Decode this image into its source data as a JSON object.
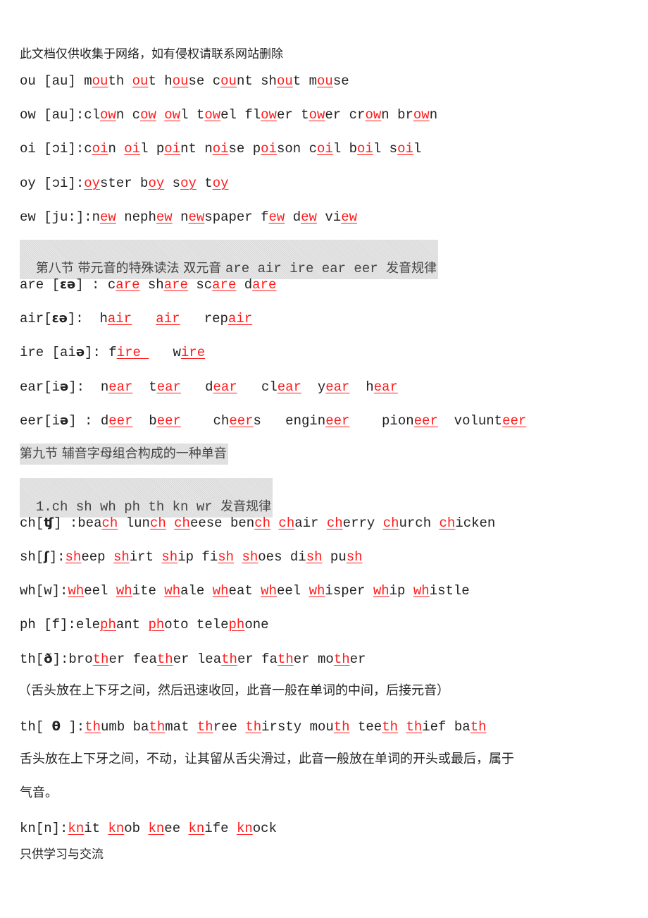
{
  "document": {
    "header_notice": "此文档仅供收集于网络，如有侵权请联系网站删除",
    "footer_notice": "只供学习与交流",
    "highlight_color": "#ff1a1a",
    "heading_bg_color": "#e2e2e2"
  },
  "lines": [
    {
      "prefix": "ou [au] ",
      "words": [
        {
          "pre": "m",
          "hl": "ou",
          "post": "th"
        },
        {
          "pre": "",
          "hl": "ou",
          "post": "t"
        },
        {
          "pre": "h",
          "hl": "ou",
          "post": "se"
        },
        {
          "pre": "c",
          "hl": "ou",
          "post": "nt"
        },
        {
          "pre": "sh",
          "hl": "ou",
          "post": "t"
        },
        {
          "pre": "m",
          "hl": "ou",
          "post": "se"
        }
      ]
    },
    {
      "prefix": "ow [au]:",
      "words": [
        {
          "pre": "cl",
          "hl": "ow",
          "post": "n"
        },
        {
          "pre": "c",
          "hl": "ow",
          "post": ""
        },
        {
          "pre": "",
          "hl": "ow",
          "post": "l"
        },
        {
          "pre": "t",
          "hl": "ow",
          "post": "el"
        },
        {
          "pre": "fl",
          "hl": "ow",
          "post": "er"
        },
        {
          "pre": "t",
          "hl": "ow",
          "post": "er"
        },
        {
          "pre": "cr",
          "hl": "ow",
          "post": "n"
        },
        {
          "pre": "br",
          "hl": "ow",
          "post": "n"
        }
      ]
    },
    {
      "prefix": "oi [ɔi]:",
      "words": [
        {
          "pre": "c",
          "hl": "oi",
          "post": "n"
        },
        {
          "pre": "",
          "hl": "oi",
          "post": "l"
        },
        {
          "pre": "p",
          "hl": "oi",
          "post": "nt"
        },
        {
          "pre": "n",
          "hl": "oi",
          "post": "se"
        },
        {
          "pre": "p",
          "hl": "oi",
          "post": "son"
        },
        {
          "pre": "c",
          "hl": "oi",
          "post": "l"
        },
        {
          "pre": "b",
          "hl": "oi",
          "post": "l"
        },
        {
          "pre": "s",
          "hl": "oi",
          "post": "l"
        }
      ]
    },
    {
      "prefix": "oy [ɔi]:",
      "words": [
        {
          "pre": "",
          "hl": "oy",
          "post": "ster"
        },
        {
          "pre": "b",
          "hl": "oy",
          "post": ""
        },
        {
          "pre": "s",
          "hl": "oy",
          "post": ""
        },
        {
          "pre": "t",
          "hl": "oy",
          "post": ""
        }
      ]
    },
    {
      "prefix": "ew [ju:]:",
      "words": [
        {
          "pre": "n",
          "hl": "ew",
          "post": ""
        },
        {
          "pre": "neph",
          "hl": "ew",
          "post": ""
        },
        {
          "pre": "n",
          "hl": "ew",
          "post": "spaper"
        },
        {
          "pre": "f",
          "hl": "ew",
          "post": ""
        },
        {
          "pre": "d",
          "hl": "ew",
          "post": ""
        },
        {
          "pre": "vi",
          "hl": "ew",
          "post": ""
        }
      ]
    }
  ],
  "section8": {
    "heading_cn1": "第八节 带元音的特殊读法 双元音 ",
    "heading_en": "are air ire ear eer ",
    "heading_cn2": "发音规律",
    "lines": [
      {
        "prefix": "are [",
        "ipa": "ɛə",
        "suffix": "] : ",
        "sep": " ",
        "words": [
          {
            "pre": "c",
            "hl": "are",
            "post": ""
          },
          {
            "pre": "sh",
            "hl": "are",
            "post": ""
          },
          {
            "pre": "sc",
            "hl": "are",
            "post": ""
          },
          {
            "pre": "d",
            "hl": "are",
            "post": ""
          }
        ]
      },
      {
        "prefix": "air[",
        "ipa": "ɛə",
        "suffix": "]:  ",
        "sep": "   ",
        "words": [
          {
            "pre": "h",
            "hl": "air",
            "post": ""
          },
          {
            "pre": "",
            "hl": "air",
            "post": ""
          },
          {
            "pre": "rep",
            "hl": "air",
            "post": ""
          }
        ]
      },
      {
        "prefix": "ire [ai",
        "ipa": "ə",
        "suffix": "]: ",
        "sep": "   ",
        "words": [
          {
            "pre": "f",
            "hl": "ire ",
            "post": ""
          },
          {
            "pre": "w",
            "hl": "ire",
            "post": ""
          }
        ]
      },
      {
        "prefix": "ear[i",
        "ipa": "ə",
        "suffix": "]:  ",
        "sep": "  ",
        "words": [
          {
            "pre": "n",
            "hl": "ear",
            "post": ""
          },
          {
            "pre": "t",
            "hl": "ear",
            "post": ""
          },
          {
            "pre": " d",
            "hl": "ear",
            "post": ""
          },
          {
            "pre": " cl",
            "hl": "ear",
            "post": ""
          },
          {
            "pre": "y",
            "hl": "ear",
            "post": ""
          },
          {
            "pre": "h",
            "hl": "ear",
            "post": ""
          }
        ]
      },
      {
        "prefix": "eer[i",
        "ipa": "ə",
        "suffix": "] : ",
        "sep": "  ",
        "words": [
          {
            "pre": "d",
            "hl": "eer",
            "post": ""
          },
          {
            "pre": "b",
            "hl": "eer",
            "post": ""
          },
          {
            "pre": "  ch",
            "hl": "eer",
            "post": "s"
          },
          {
            "pre": " engin",
            "hl": "eer",
            "post": ""
          },
          {
            "pre": "  pion",
            "hl": "eer",
            "post": ""
          },
          {
            "pre": "volunt",
            "hl": "eer",
            "post": ""
          }
        ]
      }
    ]
  },
  "section9": {
    "heading": "第九节 辅音字母组合构成的一种单音",
    "sub_heading_en": "1.ch sh wh ph th kn wr ",
    "sub_heading_cn": "发音规律",
    "lines": [
      {
        "prefix": "ch[",
        "ipa": "ʧ",
        "suffix": "] :",
        "words": [
          {
            "pre": "bea",
            "hl": "ch",
            "post": ""
          },
          {
            "pre": "lun",
            "hl": "ch",
            "post": ""
          },
          {
            "pre": "",
            "hl": "ch",
            "post": "eese"
          },
          {
            "pre": "ben",
            "hl": "ch",
            "post": ""
          },
          {
            "pre": "",
            "hl": "ch",
            "post": "air"
          },
          {
            "pre": "",
            "hl": "ch",
            "post": "erry"
          },
          {
            "pre": "",
            "hl": "ch",
            "post": "urch"
          },
          {
            "pre": "",
            "hl": "ch",
            "post": "icken"
          }
        ]
      },
      {
        "prefix": "sh[",
        "ipa": "ʃ",
        "suffix": "]:",
        "words": [
          {
            "pre": "",
            "hl": "sh",
            "post": "eep"
          },
          {
            "pre": "",
            "hl": "sh",
            "post": "irt"
          },
          {
            "pre": "",
            "hl": "sh",
            "post": "ip"
          },
          {
            "pre": "fi",
            "hl": "sh",
            "post": ""
          },
          {
            "pre": "",
            "hl": "sh",
            "post": "oes"
          },
          {
            "pre": "di",
            "hl": "sh",
            "post": ""
          },
          {
            "pre": "pu",
            "hl": "sh",
            "post": ""
          }
        ]
      },
      {
        "prefix": "wh[w]:",
        "ipa": "",
        "suffix": "",
        "words": [
          {
            "pre": "",
            "hl": "wh",
            "post": "eel"
          },
          {
            "pre": "",
            "hl": "wh",
            "post": "ite"
          },
          {
            "pre": "",
            "hl": "wh",
            "post": "ale"
          },
          {
            "pre": "",
            "hl": "wh",
            "post": "eat"
          },
          {
            "pre": "",
            "hl": "wh",
            "post": "eel"
          },
          {
            "pre": "",
            "hl": "wh",
            "post": "isper"
          },
          {
            "pre": "",
            "hl": "wh",
            "post": "ip"
          },
          {
            "pre": "",
            "hl": "wh",
            "post": "istle"
          }
        ]
      },
      {
        "prefix": "ph [f]:",
        "ipa": "",
        "suffix": "",
        "words": [
          {
            "pre": "ele",
            "hl": "ph",
            "post": "ant"
          },
          {
            "pre": "",
            "hl": "ph",
            "post": "oto"
          },
          {
            "pre": "tele",
            "hl": "ph",
            "post": "one"
          }
        ]
      },
      {
        "prefix": "th[",
        "ipa": "ð",
        "suffix": "]:",
        "words": [
          {
            "pre": "bro",
            "hl": "th",
            "post": "er"
          },
          {
            "pre": "fea",
            "hl": "th",
            "post": "er"
          },
          {
            "pre": "lea",
            "hl": "th",
            "post": "er"
          },
          {
            "pre": "fa",
            "hl": "th",
            "post": "er"
          },
          {
            "pre": "mo",
            "hl": "th",
            "post": "er"
          }
        ]
      }
    ],
    "note_voiced": "（舌头放在上下牙之间，然后迅速收回，此音一般在单词的中间，后接元音）",
    "th_voiceless": {
      "prefix": "th[ ",
      "ipa": "θ",
      "suffix": " ]:",
      "words": [
        {
          "pre": "",
          "hl": "th",
          "post": "umb"
        },
        {
          "pre": "ba",
          "hl": "th",
          "post": "mat"
        },
        {
          "pre": "",
          "hl": "th",
          "post": "ree"
        },
        {
          "pre": "",
          "hl": "th",
          "post": "irsty"
        },
        {
          "pre": "mou",
          "hl": "th",
          "post": ""
        },
        {
          "pre": "tee",
          "hl": "th",
          "post": ""
        },
        {
          "pre": "",
          "hl": "th",
          "post": "ief"
        },
        {
          "pre": "ba",
          "hl": "th",
          "post": ""
        }
      ]
    },
    "note_voiceless_line1": "舌头放在上下牙之间，不动，让其留从舌尖滑过，此音一般放在单词的开头或最后，属于",
    "note_voiceless_line2": "气音。",
    "kn": {
      "prefix": "kn[n]:",
      "ipa": "",
      "suffix": "",
      "words": [
        {
          "pre": "",
          "hl": "kn",
          "post": "it"
        },
        {
          "pre": "",
          "hl": "kn",
          "post": "ob"
        },
        {
          "pre": "",
          "hl": "kn",
          "post": "ee"
        },
        {
          "pre": "",
          "hl": "kn",
          "post": "ife"
        },
        {
          "pre": "",
          "hl": "kn",
          "post": "ock"
        }
      ]
    }
  }
}
